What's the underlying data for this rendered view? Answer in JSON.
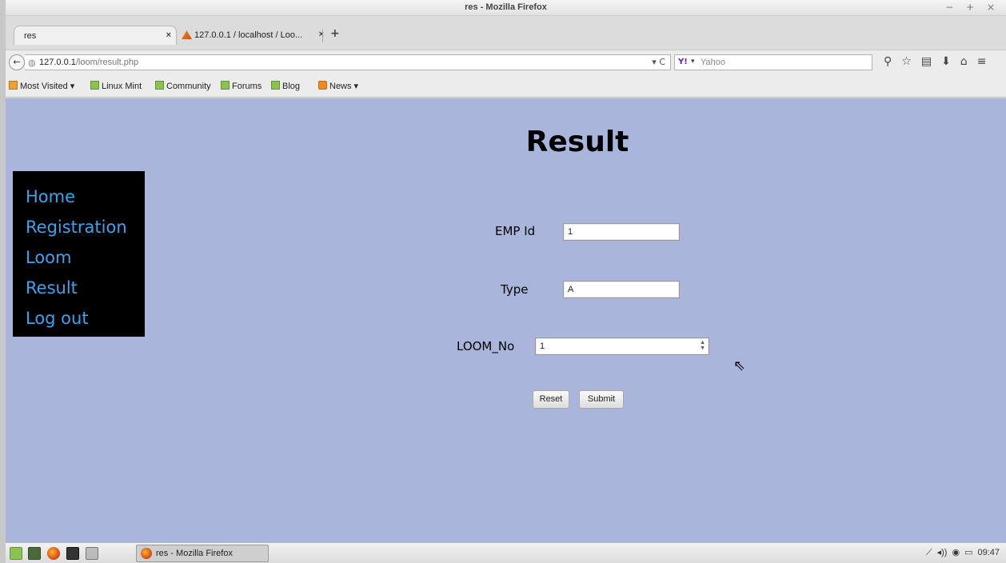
{
  "window": {
    "title": "res - Mozilla Firefox",
    "controls": "− + ×"
  },
  "tabs": [
    {
      "title": "res",
      "close": "×",
      "active": true
    },
    {
      "title": "127.0.0.1 / localhost / Loo...",
      "close": "×",
      "active": false
    }
  ],
  "new_tab_label": "+",
  "navbar": {
    "back": "←",
    "url_host": "127.0.0.1",
    "url_path": "/loom/result.php",
    "url_controls": "▾ C",
    "search_engine": "Yahoo",
    "search_engine_mark": "Y!",
    "search_placeholder": "Yahoo",
    "search_go": "⚲",
    "toolbar_icons": [
      "⚲",
      "☆",
      "▤",
      "⬇",
      "⌂",
      "≡"
    ]
  },
  "bookmarks": [
    {
      "label": "Most Visited ▾",
      "icon": "folder-icon"
    },
    {
      "label": "Linux Mint",
      "icon": "mint-icon"
    },
    {
      "label": "Community",
      "icon": "mint-icon"
    },
    {
      "label": "Forums",
      "icon": "mint-icon"
    },
    {
      "label": "Blog",
      "icon": "mint-icon"
    },
    {
      "label": "News ▾",
      "icon": "rss-icon"
    }
  ],
  "page": {
    "title": "Result",
    "background": "#a9b5db",
    "menu": [
      "Home",
      "Registration",
      "Loom",
      "Result",
      "Log out"
    ],
    "menu_color": "#3fa2ea",
    "form": {
      "emp_id_label": "EMP Id",
      "emp_id_value": "1",
      "type_label": "Type",
      "type_value": "A",
      "loom_no_label": "LOOM_No",
      "loom_no_value": "1",
      "reset_label": "Reset",
      "submit_label": "Submit"
    }
  },
  "taskbar": {
    "task_label": "res - Mozilla Firefox",
    "clock": "09:47"
  }
}
